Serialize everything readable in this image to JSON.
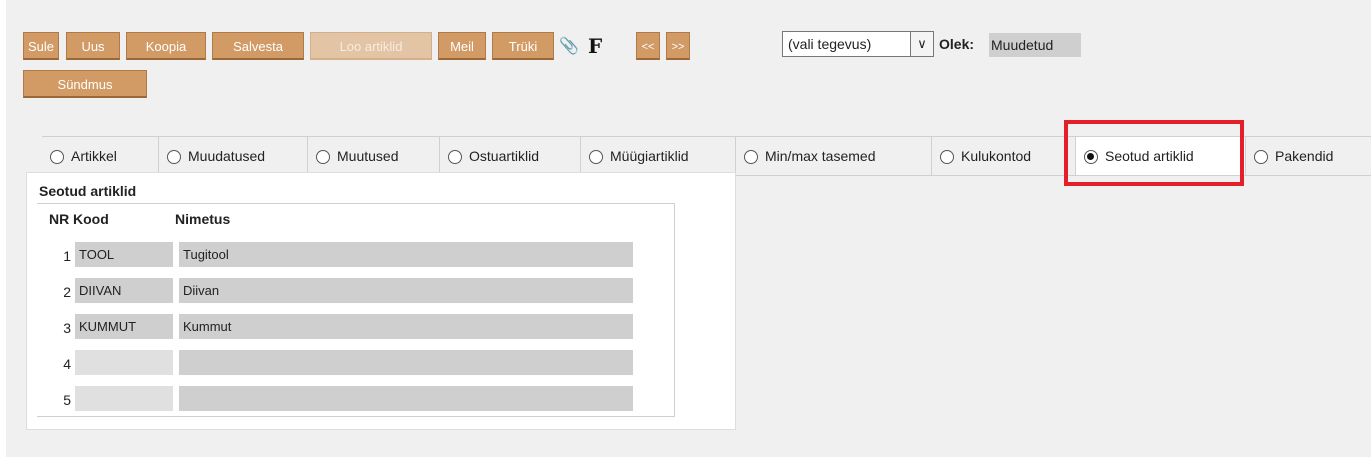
{
  "toolbar": {
    "buttons": [
      "Sule",
      "Uus",
      "Koopia",
      "Salvesta",
      "Loo artiklid",
      "Meil",
      "Trüki"
    ],
    "attach_glyph": "📎",
    "f_label": "F",
    "prev_label": "<<",
    "next_label": ">>",
    "second_row_button": "Sündmus",
    "action_select": {
      "value": "(vali tegevus)",
      "arrow": "∨"
    },
    "status_label": "Olek:",
    "status_value": "Muudetud"
  },
  "tabs": [
    {
      "label": "Artikkel",
      "selected": false
    },
    {
      "label": "Muudatused",
      "selected": false
    },
    {
      "label": "Muutused",
      "selected": false
    },
    {
      "label": "Ostuartiklid",
      "selected": false
    },
    {
      "label": "Müügiartiklid",
      "selected": false
    },
    {
      "label": "Min/max tasemed",
      "selected": false
    },
    {
      "label": "Kulukontod",
      "selected": false
    },
    {
      "label": "Seotud artiklid",
      "selected": true
    },
    {
      "label": "Pakendid",
      "selected": false
    }
  ],
  "section": {
    "title": "Seotud artiklid",
    "columns": [
      "NR",
      "Kood",
      "Nimetus"
    ],
    "rows": [
      {
        "nr": "1",
        "kood": "TOOL",
        "nimetus": "Tugitool"
      },
      {
        "nr": "2",
        "kood": "DIIVAN",
        "nimetus": "Diivan"
      },
      {
        "nr": "3",
        "kood": "KUMMUT",
        "nimetus": "Kummut"
      },
      {
        "nr": "4",
        "kood": "",
        "nimetus": ""
      },
      {
        "nr": "5",
        "kood": "",
        "nimetus": ""
      }
    ]
  },
  "colors": {
    "button": "#d29b66",
    "highlight": "#e3202a",
    "panel": "#f0f0f0"
  }
}
